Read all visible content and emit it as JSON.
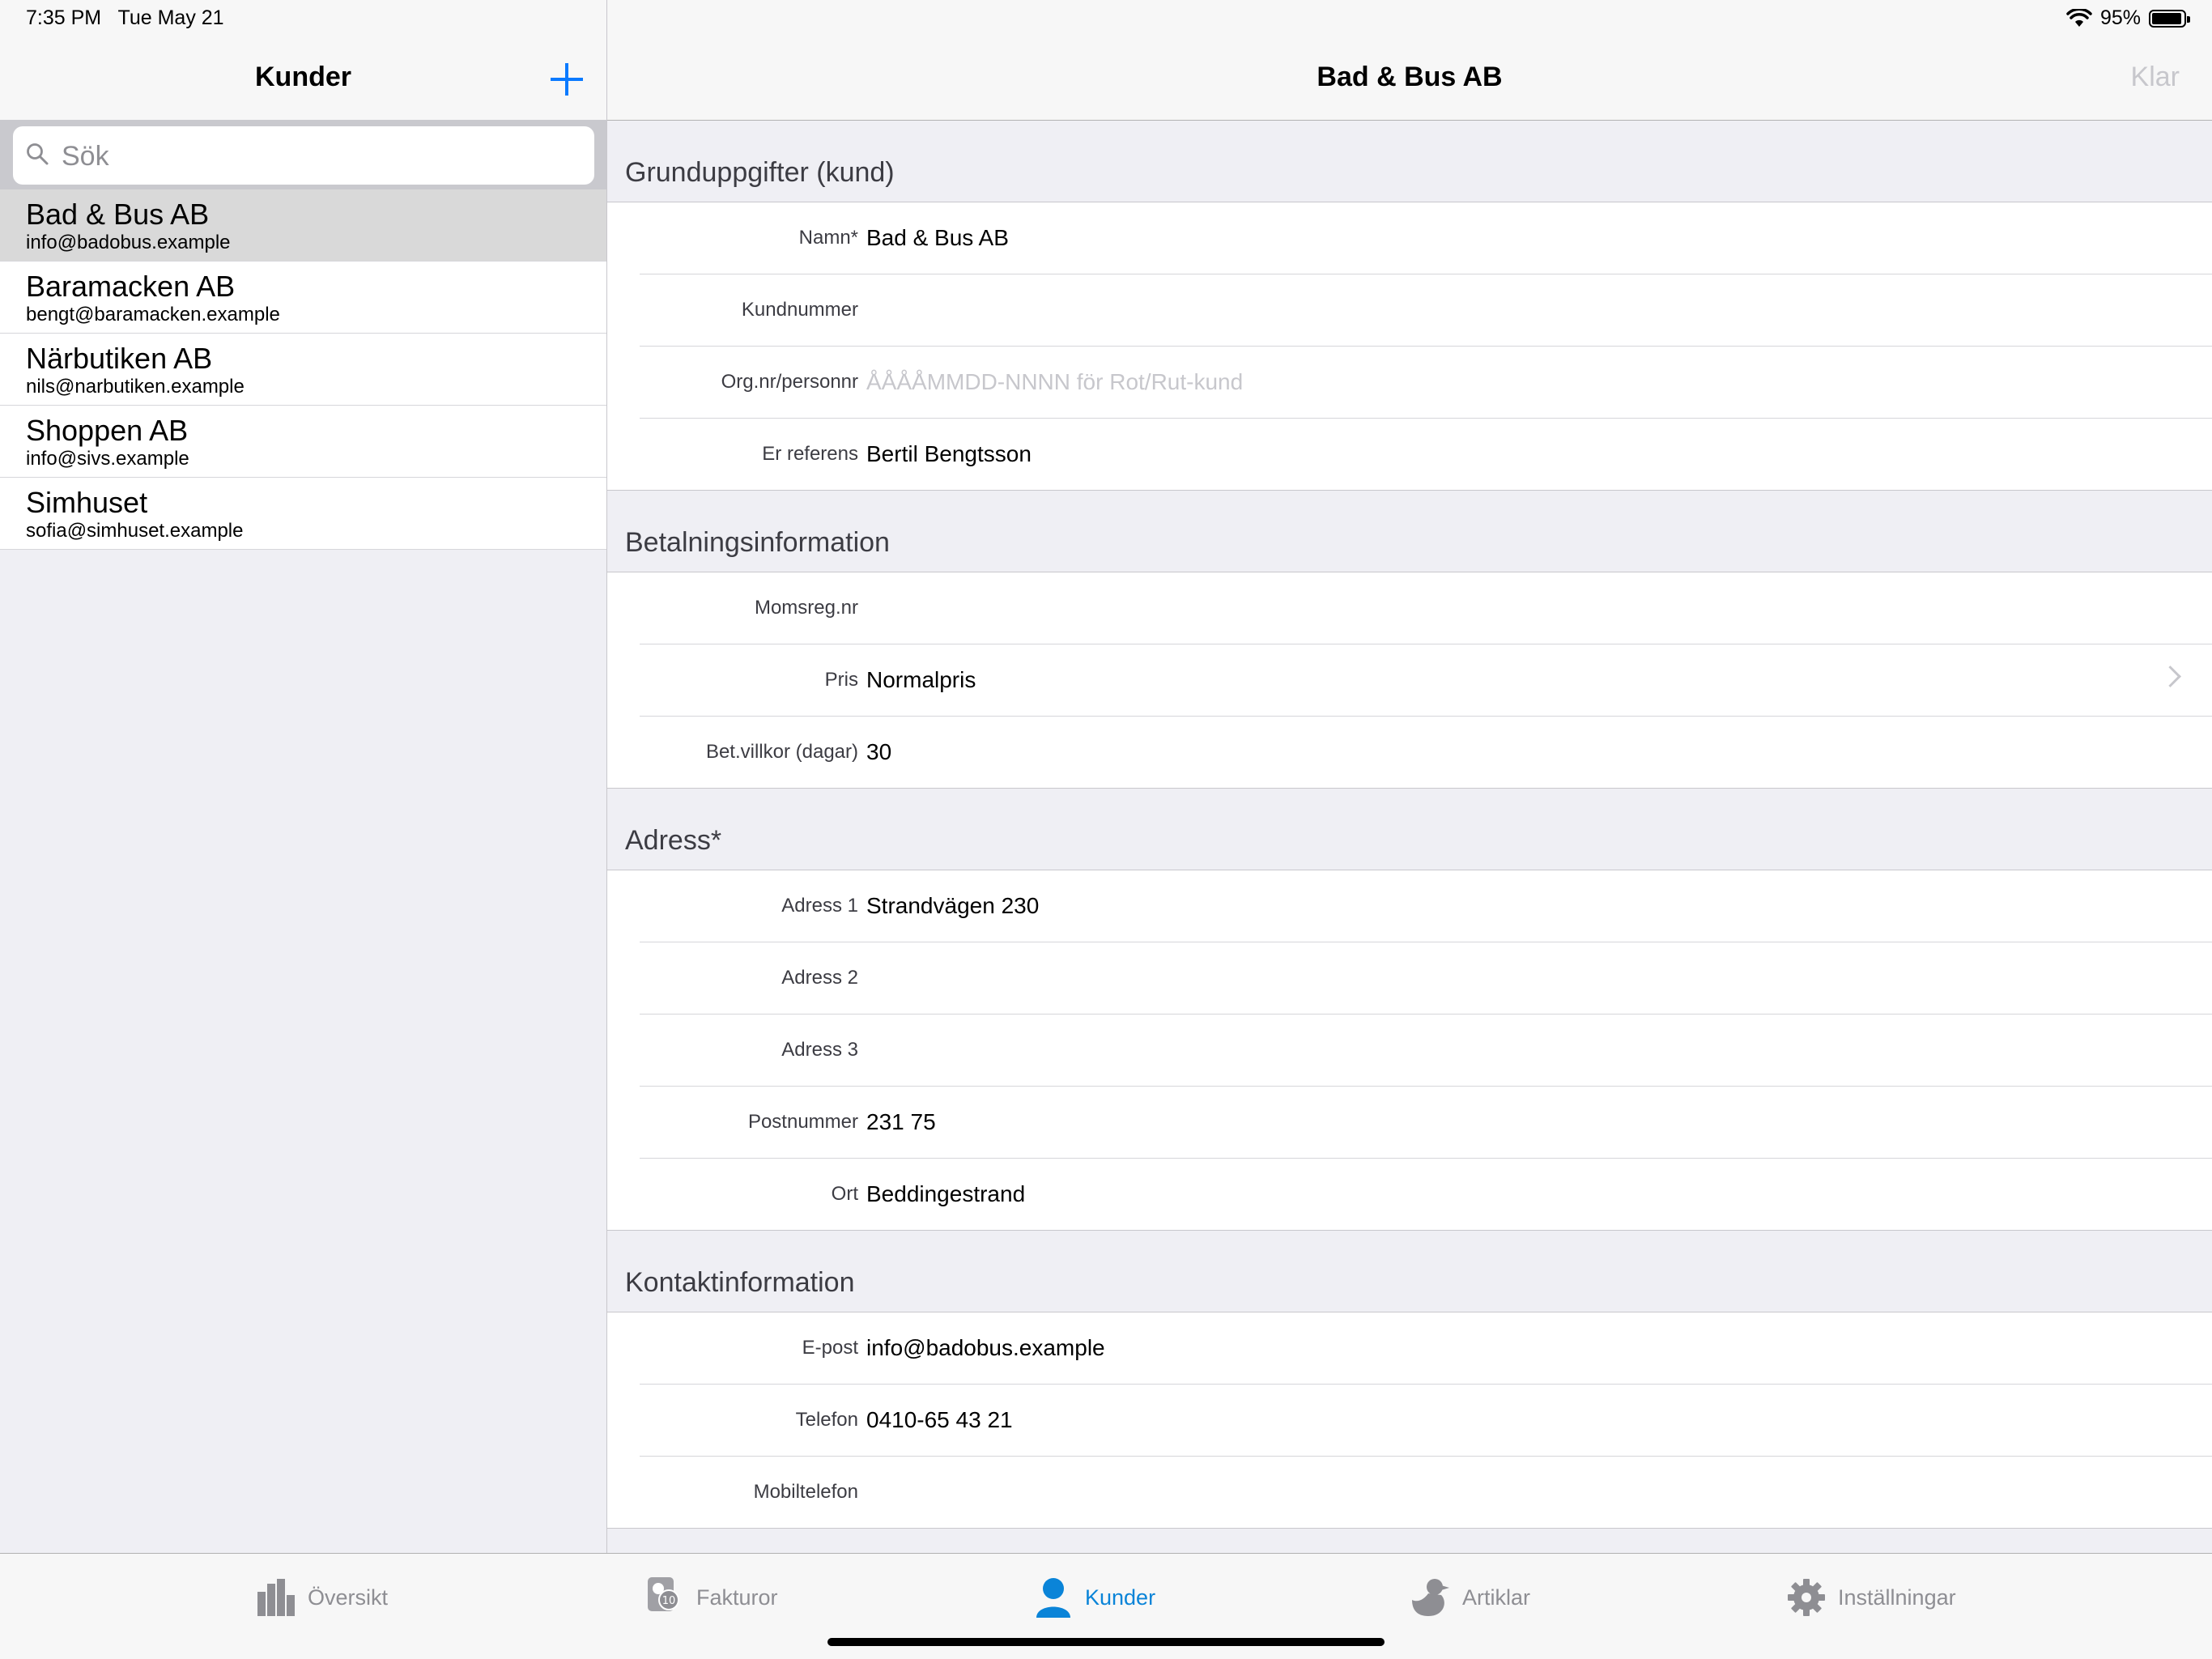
{
  "status": {
    "time": "7:35 PM",
    "date": "Tue May 21",
    "battery": "95%",
    "battery_level": 0.95
  },
  "master": {
    "title": "Kunder",
    "search": {
      "placeholder": "Sök",
      "value": ""
    },
    "customers": [
      {
        "name": "Bad & Bus AB",
        "email": "info@badobus.example",
        "selected": true
      },
      {
        "name": "Baramacken AB",
        "email": "bengt@baramacken.example",
        "selected": false
      },
      {
        "name": "Närbutiken AB",
        "email": "nils@narbutiken.example",
        "selected": false
      },
      {
        "name": "Shoppen AB",
        "email": "info@sivs.example",
        "selected": false
      },
      {
        "name": "Simhuset",
        "email": "sofia@simhuset.example",
        "selected": false
      }
    ]
  },
  "detail": {
    "title": "Bad & Bus AB",
    "done_label": "Klar",
    "sections": [
      {
        "title": "Grunduppgifter (kund)",
        "rows": [
          {
            "label": "Namn*",
            "value": "Bad & Bus AB"
          },
          {
            "label": "Kundnummer",
            "value": ""
          },
          {
            "label": "Org.nr/personnr",
            "value": "",
            "placeholder": "ÅÅÅÅMMDD-NNNN för Rot/Rut-kund"
          },
          {
            "label": "Er referens",
            "value": "Bertil Bengtsson"
          }
        ]
      },
      {
        "title": "Betalningsinformation",
        "rows": [
          {
            "label": "Momsreg.nr",
            "value": ""
          },
          {
            "label": "Pris",
            "value": "Normalpris",
            "disclosure": true
          },
          {
            "label": "Bet.villkor (dagar)",
            "value": "30"
          }
        ]
      },
      {
        "title": "Adress*",
        "rows": [
          {
            "label": "Adress 1",
            "value": "Strandvägen 230"
          },
          {
            "label": "Adress 2",
            "value": ""
          },
          {
            "label": "Adress 3",
            "value": ""
          },
          {
            "label": "Postnummer",
            "value": "231 75"
          },
          {
            "label": "Ort",
            "value": "Beddingestrand"
          }
        ]
      },
      {
        "title": "Kontaktinformation",
        "rows": [
          {
            "label": "E-post",
            "value": "info@badobus.example"
          },
          {
            "label": "Telefon",
            "value": "0410-65 43 21"
          },
          {
            "label": "Mobiltelefon",
            "value": ""
          }
        ]
      }
    ]
  },
  "tabbar": {
    "active": "Kunder",
    "tabs": [
      {
        "label": "Översikt",
        "icon": "bar-chart-icon"
      },
      {
        "label": "Fakturor",
        "icon": "invoice-icon"
      },
      {
        "label": "Kunder",
        "icon": "person-icon"
      },
      {
        "label": "Artiklar",
        "icon": "duck-icon"
      },
      {
        "label": "Inställningar",
        "icon": "gear-icon"
      }
    ]
  },
  "colors": {
    "accent": "#0a84d8",
    "plus": "#0a7aff",
    "selected_row": "#d9d9d9",
    "background": "#efeff4"
  }
}
